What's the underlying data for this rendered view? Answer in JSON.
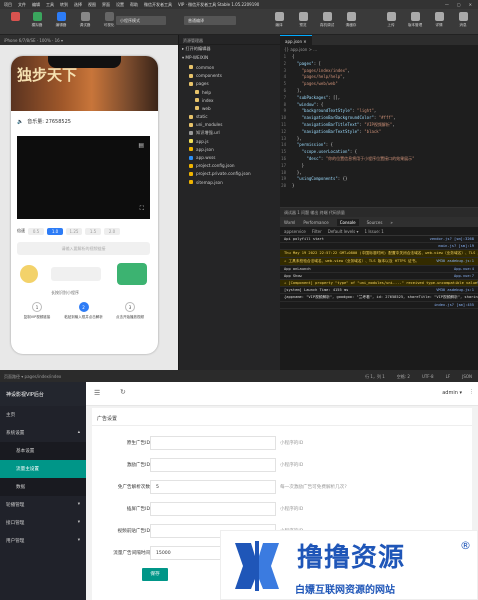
{
  "ide": {
    "menu": [
      "项目",
      "文件",
      "编辑",
      "工具",
      "转到",
      "选择",
      "视图",
      "界面",
      "设置",
      "帮助",
      "微信开发者工具",
      "VIP · 微信开发者工具 Stable 1.05.2209190"
    ],
    "window_controls": [
      "—",
      "▢",
      "✕"
    ],
    "toolbar": {
      "left": [
        "模拟器",
        "编辑器",
        "调试器",
        "可视化"
      ],
      "compile_select": "小程序模式",
      "mode_select": "普通编译",
      "mid": [
        "编译",
        "预览",
        "真机调试",
        "清缓存"
      ],
      "right": [
        "上传",
        "版本管理",
        "详情",
        "消息"
      ]
    },
    "sim_header": "iPhone 6/7/8/SE · 100% · 16 ▾",
    "phone": {
      "banner_title": "独步天下",
      "volume_label": "音乐量: 27658525",
      "speed_label": "倍速",
      "speeds": [
        "0.5",
        "1.0",
        "1.25",
        "1.5",
        "2.0"
      ],
      "active_speed_index": 1,
      "parse_placeholder": "请输入要解析的视频链接",
      "ad_tip": "长按识别小程序",
      "steps": [
        {
          "num": "1",
          "label": "复制VIP视频链接"
        },
        {
          "num": "2",
          "label": "粘贴到输入框并点击解析"
        },
        {
          "num": "3",
          "label": "点击开始播放视频"
        }
      ]
    },
    "sim_status": "页面路径 ▾  pages/index/index",
    "explorer": {
      "header": "资源管理器",
      "open_editors": "▸ 打开的编辑器",
      "project": "▾ MP-WEIXIN",
      "items": [
        {
          "name": "common",
          "color": "#e8c36a",
          "indent": 1
        },
        {
          "name": "components",
          "color": "#e8c36a",
          "indent": 1
        },
        {
          "name": "pages",
          "color": "#e8c36a",
          "indent": 1
        },
        {
          "name": "help",
          "color": "#e8c36a",
          "indent": 2
        },
        {
          "name": "index",
          "color": "#e8c36a",
          "indent": 2
        },
        {
          "name": "web",
          "color": "#e8c36a",
          "indent": 2
        },
        {
          "name": "static",
          "color": "#e8c36a",
          "indent": 1
        },
        {
          "name": "uni_modules",
          "color": "#e8c36a",
          "indent": 1
        },
        {
          "name": "知识增强.url",
          "color": "#999",
          "indent": 1
        },
        {
          "name": "app.js",
          "color": "#f1e05a",
          "indent": 1
        },
        {
          "name": "app.json",
          "color": "#f0b400",
          "indent": 1
        },
        {
          "name": "app.wxss",
          "color": "#2d8ef5",
          "indent": 1
        },
        {
          "name": "project.config.json",
          "color": "#f0b400",
          "indent": 1
        },
        {
          "name": "project.private.config.json",
          "color": "#f0b400",
          "indent": 1
        },
        {
          "name": "sitemap.json",
          "color": "#f0b400",
          "indent": 1
        }
      ],
      "outline": "▸ 大纲"
    },
    "editor": {
      "tab": "app.json ✕",
      "breadcrumb": "{} app.json > ...",
      "lines": [
        {
          "n": "1",
          "t": "{"
        },
        {
          "n": "2",
          "t": "  \"pages\": ["
        },
        {
          "n": "3",
          "t": "    \"pages/index/index\","
        },
        {
          "n": "4",
          "t": "    \"pages/help/help\","
        },
        {
          "n": "5",
          "t": "    \"pages/web/web\""
        },
        {
          "n": "6",
          "t": "  ],"
        },
        {
          "n": "7",
          "t": "  \"subPackages\": [],"
        },
        {
          "n": "8",
          "t": "  \"window\": {"
        },
        {
          "n": "9",
          "t": "    \"backgroundTextStyle\": \"light\","
        },
        {
          "n": "10",
          "t": "    \"navigationBarBackgroundColor\": \"#fff\","
        },
        {
          "n": "11",
          "t": "    \"navigationBarTitleText\": \"VIP视频解析\","
        },
        {
          "n": "12",
          "t": "    \"navigationBarTextStyle\": \"black\""
        },
        {
          "n": "13",
          "t": "  },"
        },
        {
          "n": "14",
          "t": "  \"permission\": {"
        },
        {
          "n": "15",
          "t": "    \"scope.userLocation\": {"
        },
        {
          "n": "16",
          "t": "      \"desc\": \"你的位置信息将用于小程序位置接口的效果展示\""
        },
        {
          "n": "17",
          "t": "    }"
        },
        {
          "n": "18",
          "t": "  },"
        },
        {
          "n": "19",
          "t": "  \"usingComponents\": {}"
        },
        {
          "n": "20",
          "t": "}"
        }
      ]
    },
    "devtools": {
      "title": "调试器  1  问题  输出  终端  代码质量",
      "tabs": [
        "Wxml",
        "Performance",
        "Console",
        "Sources",
        "»"
      ],
      "active_tab": "Console",
      "filter": [
        "appservice",
        "Filter",
        "Default levels ▾",
        "1 Issue: 1"
      ],
      "lines": [
        {
          "t": "Api polyfill start",
          "r": "vendor.js? [sm]:3268",
          "w": false
        },
        {
          "t": "",
          "r": "main.js? [sm]:19",
          "w": false
        },
        {
          "t": "Thu May 19 2022 22:57:22 GMT+0800 (中国标准时间) 配置中关闭合法域名、web-view（业务域名）、TLS 版本以及 HTTPS 证书检查",
          "r": "VM30 asdebug.js:1",
          "w": true
        },
        {
          "t": "⚠ 工具未校验合法域名、web-view（业务域名）、TLS 版本以及 HTTPS 证书。",
          "r": "VM30 asdebug.js:1",
          "w": true
        },
        {
          "t": "App onLaunch",
          "r": "App.vue:4",
          "w": false
        },
        {
          "t": "App Show",
          "r": "App.vue:7",
          "w": false
        },
        {
          "t": "⚠ [Component] property \"type\" of \"uni_modules/uni-...\" received type-uncompatible value",
          "r": "VM30 asdebug.js:1",
          "w": true
        },
        {
          "t": "[system] Launch Time: 4155 ms",
          "r": "VM30 asdebug.js:1",
          "w": false
        },
        {
          "t": "{appname: \"VIP视频解析\", goodgoo: \"兰考看\", id: 27658525, shareTitle: \"VIP视频解析\", sharing: \"\", ctd: \"\", …}",
          "r": "index.js? [sm]:345",
          "w": false
        },
        {
          "t": "",
          "r": "index.js? [sm]:455",
          "w": false
        }
      ]
    },
    "statusbar": [
      "行 1，列 1",
      "空格: 2",
      "UTF-8",
      "LF",
      "JSON"
    ]
  },
  "admin": {
    "logo": "神设影视VIP后台",
    "menu": [
      {
        "label": "主页",
        "kind": "top",
        "arrow": ""
      },
      {
        "label": "系统设置",
        "kind": "top",
        "arrow": "▴"
      },
      {
        "label": "基本设置",
        "kind": "sub",
        "arrow": ""
      },
      {
        "label": "流量主设置",
        "kind": "active",
        "arrow": ""
      },
      {
        "label": "数据",
        "kind": "sub",
        "arrow": ""
      },
      {
        "label": "轮播管理",
        "kind": "top",
        "arrow": "▾"
      },
      {
        "label": "接口管理",
        "kind": "top",
        "arrow": "▾"
      },
      {
        "label": "用户管理",
        "kind": "top",
        "arrow": "▾"
      }
    ],
    "user": "admin ▾",
    "panel_title": "广告设置",
    "fields": [
      {
        "label": "原生广告ID",
        "value": "",
        "tip": "小程序的ID"
      },
      {
        "label": "激励广告ID",
        "value": "",
        "tip": "小程序的ID"
      },
      {
        "label": "免广告解析次数",
        "value": "5",
        "tip": "每一次激励广告可免费解析几次?"
      },
      {
        "label": "插屏广告ID",
        "value": "",
        "tip": "小程序的ID"
      },
      {
        "label": "视频前贴广告ID",
        "value": "",
        "tip": "小程序的ID"
      },
      {
        "label": "流量广告间隔时间",
        "value": "15000",
        "tip": "视频次数（毫秒）"
      }
    ],
    "save_label": "保存"
  },
  "watermark": {
    "big": "撸撸资源",
    "reg": "®",
    "small": "白嫖互联网资源的网站"
  },
  "colors": {
    "accent": "#009688",
    "brand": "#1f56b8",
    "sidebar": "#20222a",
    "primary": "#2d7cf6"
  }
}
